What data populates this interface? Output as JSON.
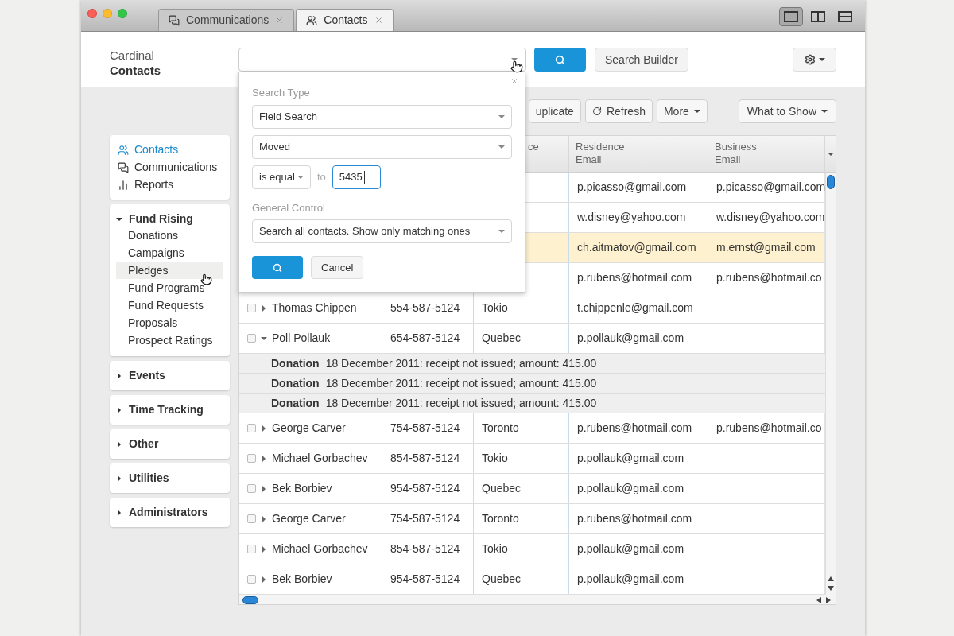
{
  "window": {
    "tabs": [
      {
        "label": "Communications",
        "kind": "chat",
        "selected": false
      },
      {
        "label": "Contacts",
        "kind": "users",
        "selected": true
      }
    ],
    "view_buttons": [
      {
        "kind": "single",
        "selected": true
      },
      {
        "kind": "columns",
        "selected": false
      },
      {
        "kind": "rows",
        "selected": false
      }
    ]
  },
  "header": {
    "app_name": "Cardinal",
    "section": "Contacts",
    "search_button": {
      "kind": "search"
    },
    "search_builder": "Search Builder"
  },
  "search_popup": {
    "search_type_label": "Search Type",
    "search_type": "Field Search",
    "field": "Moved",
    "operator": "is equal",
    "to_label": "to",
    "value": "5435",
    "general_label": "General Control",
    "general": "Search all contacts. Show only matching ones",
    "cancel": "Cancel"
  },
  "sidebar": {
    "nav": [
      {
        "label": "Contacts",
        "kind": "users",
        "selected": true
      },
      {
        "label": "Communications",
        "kind": "chat",
        "selected": false
      },
      {
        "label": "Reports",
        "kind": "bars",
        "selected": false
      }
    ],
    "groups": [
      {
        "label": "Fund Rising",
        "expanded": true,
        "items": [
          {
            "label": "Donations",
            "hovered": false
          },
          {
            "label": "Campaigns",
            "hovered": false
          },
          {
            "label": "Pledges",
            "hovered": true
          },
          {
            "label": "Fund Programs",
            "hovered": false
          },
          {
            "label": "Fund Requests",
            "hovered": false
          },
          {
            "label": "Proposals",
            "hovered": false
          },
          {
            "label": "Prospect Ratings",
            "hovered": false
          }
        ]
      },
      {
        "label": "Events",
        "expanded": false
      },
      {
        "label": "Time Tracking",
        "expanded": false
      },
      {
        "label": "Other",
        "expanded": false
      },
      {
        "label": "Utilities",
        "expanded": false
      },
      {
        "label": "Administrators",
        "expanded": false
      }
    ]
  },
  "toolbar": [
    {
      "label": "uplicate",
      "kind": "plain"
    },
    {
      "label": "Refresh",
      "kind": "refresh"
    },
    {
      "label": "More",
      "kind": "menu"
    }
  ],
  "what_to_show": "What to Show",
  "table": {
    "columns": [
      {
        "label": "ce"
      },
      {
        "label": "Residence Email"
      },
      {
        "label": "Business Email"
      }
    ],
    "rows": [
      {
        "kind": "contact",
        "highlighted": false,
        "residence_email": "p.picasso@gmail.com",
        "business_email": "p.picasso@gmail.com"
      },
      {
        "kind": "contact",
        "highlighted": false,
        "residence_email": "w.disney@yahoo.com",
        "business_email": "w.disney@yahoo.com"
      },
      {
        "kind": "contact",
        "highlighted": true,
        "residence_email": "ch.aitmatov@gmail.com",
        "business_email": "m.ernst@gmail.com"
      },
      {
        "kind": "contact",
        "highlighted": false,
        "residence_email": "p.rubens@hotmail.com",
        "business_email": "p.rubens@hotmail.co"
      },
      {
        "kind": "contact",
        "highlighted": false,
        "checked": false,
        "expanded": false,
        "name": "Thomas Chippen",
        "phone": "554-587-5124",
        "column_3": "Tokio",
        "residence_email": "t.chippenle@gmail.com"
      },
      {
        "kind": "contact",
        "highlighted": false,
        "checked": false,
        "expanded": true,
        "name": "Poll Pollauk",
        "phone": "654-587-5124",
        "column_3": "Quebec",
        "residence_email": "p.pollauk@gmail.com"
      },
      {
        "kind": "detail",
        "label": "Donation",
        "text": "18 December 2011: receipt not issued; amount: 415.00"
      },
      {
        "kind": "detail",
        "label": "Donation",
        "text": "18 December 2011: receipt not issued; amount: 415.00"
      },
      {
        "kind": "detail",
        "label": "Donation",
        "text": "18 December 2011: receipt not issued; amount: 415.00"
      },
      {
        "kind": "contact",
        "highlighted": false,
        "checked": false,
        "expanded": false,
        "name": "George Carver",
        "phone": "754-587-5124",
        "column_3": "Toronto",
        "residence_email": "p.rubens@hotmail.com",
        "business_email": "p.rubens@hotmail.co"
      },
      {
        "kind": "contact",
        "highlighted": false,
        "checked": false,
        "expanded": false,
        "name": "Michael Gorbachev",
        "phone": "854-587-5124",
        "column_3": "Tokio",
        "residence_email": "p.pollauk@gmail.com"
      },
      {
        "kind": "contact",
        "highlighted": false,
        "checked": false,
        "expanded": false,
        "name": "Bek Borbiev",
        "phone": "954-587-5124",
        "column_3": "Quebec",
        "residence_email": "p.pollauk@gmail.com"
      },
      {
        "kind": "contact",
        "highlighted": false,
        "checked": false,
        "expanded": false,
        "name": "George Carver",
        "phone": "754-587-5124",
        "column_3": "Toronto",
        "residence_email": "p.rubens@hotmail.com"
      },
      {
        "kind": "contact",
        "highlighted": false,
        "checked": false,
        "expanded": false,
        "name": "Michael Gorbachev",
        "phone": "854-587-5124",
        "column_3": "Tokio",
        "residence_email": "p.pollauk@gmail.com"
      },
      {
        "kind": "contact",
        "highlighted": false,
        "checked": false,
        "expanded": false,
        "name": "Bek Borbiev",
        "phone": "954-587-5124",
        "column_3": "Quebec",
        "residence_email": "p.pollauk@gmail.com"
      }
    ]
  }
}
